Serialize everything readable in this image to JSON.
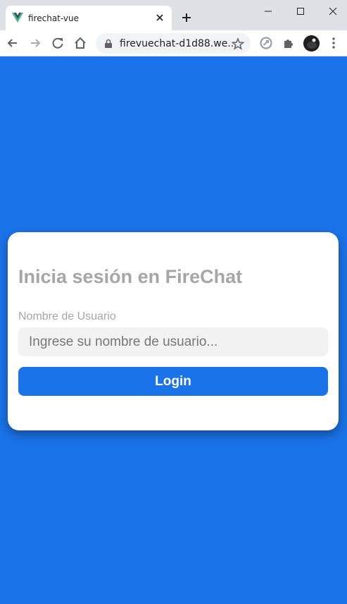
{
  "browser": {
    "tab": {
      "title": "firechat-vue"
    },
    "address_bar": {
      "url": "firevuechat-d1d88.we..."
    },
    "icons": [
      "vue-favicon-icon",
      "close-icon",
      "plus-icon",
      "minimize-icon",
      "maximize-icon",
      "window-close-icon",
      "back-arrow-icon",
      "forward-arrow-icon",
      "reload-icon",
      "home-icon",
      "lock-icon",
      "star-icon",
      "extension-sync-icon",
      "puzzle-icon",
      "kebab-menu-icon"
    ]
  },
  "login": {
    "title": "Inicia sesión en FireChat",
    "username_label": "Nombre de Usuario",
    "username_value": "",
    "username_placeholder": "Ingrese su nombre de usuario...",
    "submit_label": "Login"
  },
  "colors": {
    "page_background": "#1a73e8",
    "button_background": "#1a73e8",
    "card_background": "#ffffff",
    "muted_text": "#a6a6a6",
    "input_background": "#f2f2f2"
  }
}
